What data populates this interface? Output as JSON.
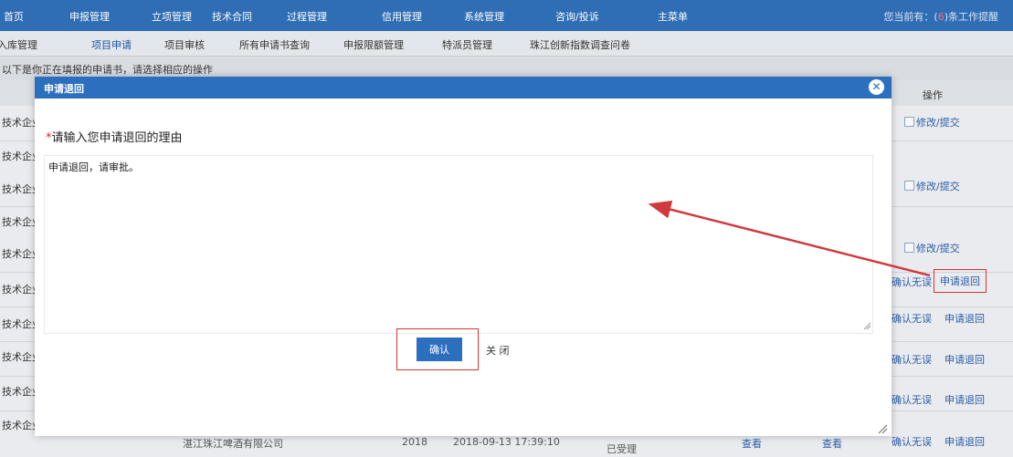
{
  "topnav": {
    "items": [
      "首页",
      "申报管理",
      "立项管理",
      "技术合同",
      "过程管理",
      "信用管理",
      "系统管理",
      "咨询/投诉",
      "主菜单"
    ],
    "alert_prefix": "您当前有：(",
    "alert_count": "6",
    "alert_suffix": ")条工作提醒"
  },
  "subnav": {
    "items": [
      "导入库管理",
      "项目申请",
      "项目审核",
      "所有申请书查询",
      "申报限额管理",
      "特派员管理",
      "珠江创新指数调查问卷"
    ],
    "active_index": 1
  },
  "hint": "以下是你正在填报的申请书，请选择相应的操作",
  "table": {
    "op_header": "操作",
    "row_label": "技术企业",
    "last_row_label": "技术企业认定",
    "rows": [
      {
        "op": "edit",
        "edit_label": "修改/",
        "submit_label": "提交"
      },
      {
        "op": "edit",
        "edit_label": "修改/",
        "submit_label": "提交"
      },
      {
        "op": "edit",
        "edit_label": "修改/",
        "submit_label": "提交"
      },
      {
        "op": "withdraw",
        "confirm_label": "确认无误",
        "withdraw_label": "申请退回",
        "highlight": true
      },
      {
        "op": "withdraw",
        "confirm_label": "确认无误",
        "withdraw_label": "申请退回"
      },
      {
        "op": "withdraw",
        "confirm_label": "确认无误",
        "withdraw_label": "申请退回"
      },
      {
        "op": "withdraw",
        "confirm_label": "确认无误",
        "withdraw_label": "申请退回"
      }
    ],
    "bottom": {
      "company": "湛江珠江啤酒有限公司",
      "year": "2018",
      "datetime": "2018-09-13 17:39:10",
      "status": "已受理",
      "view1": "查看",
      "view2": "查看"
    }
  },
  "dialog": {
    "title": "申请退回",
    "close_glyph": "✕",
    "prompt_required": "*",
    "prompt": "请输入您申请退回的理由",
    "reason_value": "申请退回，请审批。",
    "confirm_label": "确认",
    "close_label": "关 闭"
  },
  "colors": {
    "topnav": "#2f6db4",
    "dialog_title": "#2d6fbf",
    "highlight_border": "#dd3333",
    "arrow": "#d0393d"
  }
}
